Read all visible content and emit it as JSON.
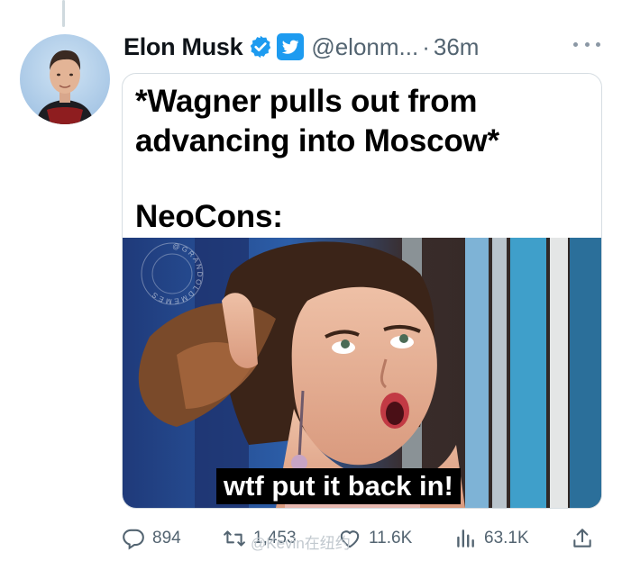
{
  "tweet": {
    "author_name": "Elon Musk",
    "handle": "@elonm...",
    "separator": "·",
    "time": "36m"
  },
  "meme": {
    "line1": "*Wagner pulls out from",
    "line2": "advancing into Moscow*",
    "line3": "NeoCons:",
    "caption": "wtf put it back in!",
    "watermark_ring": "@GRANDOLDMEMES"
  },
  "actions": {
    "reply_count": "894",
    "retweet_count": "1,453",
    "like_count": "11.6K",
    "views_count": "63.1K"
  },
  "overlay_watermark": "@Kevin在纽约",
  "icons": {
    "verified": "verified-badge-icon",
    "twitter": "twitter-bird-icon",
    "more": "more-icon",
    "reply": "reply-icon",
    "retweet": "retweet-icon",
    "like": "heart-icon",
    "views": "views-chart-icon",
    "share": "share-icon"
  },
  "colors": {
    "accent": "#1d9bf0",
    "muted_text": "#536471",
    "text": "#0f1419"
  }
}
